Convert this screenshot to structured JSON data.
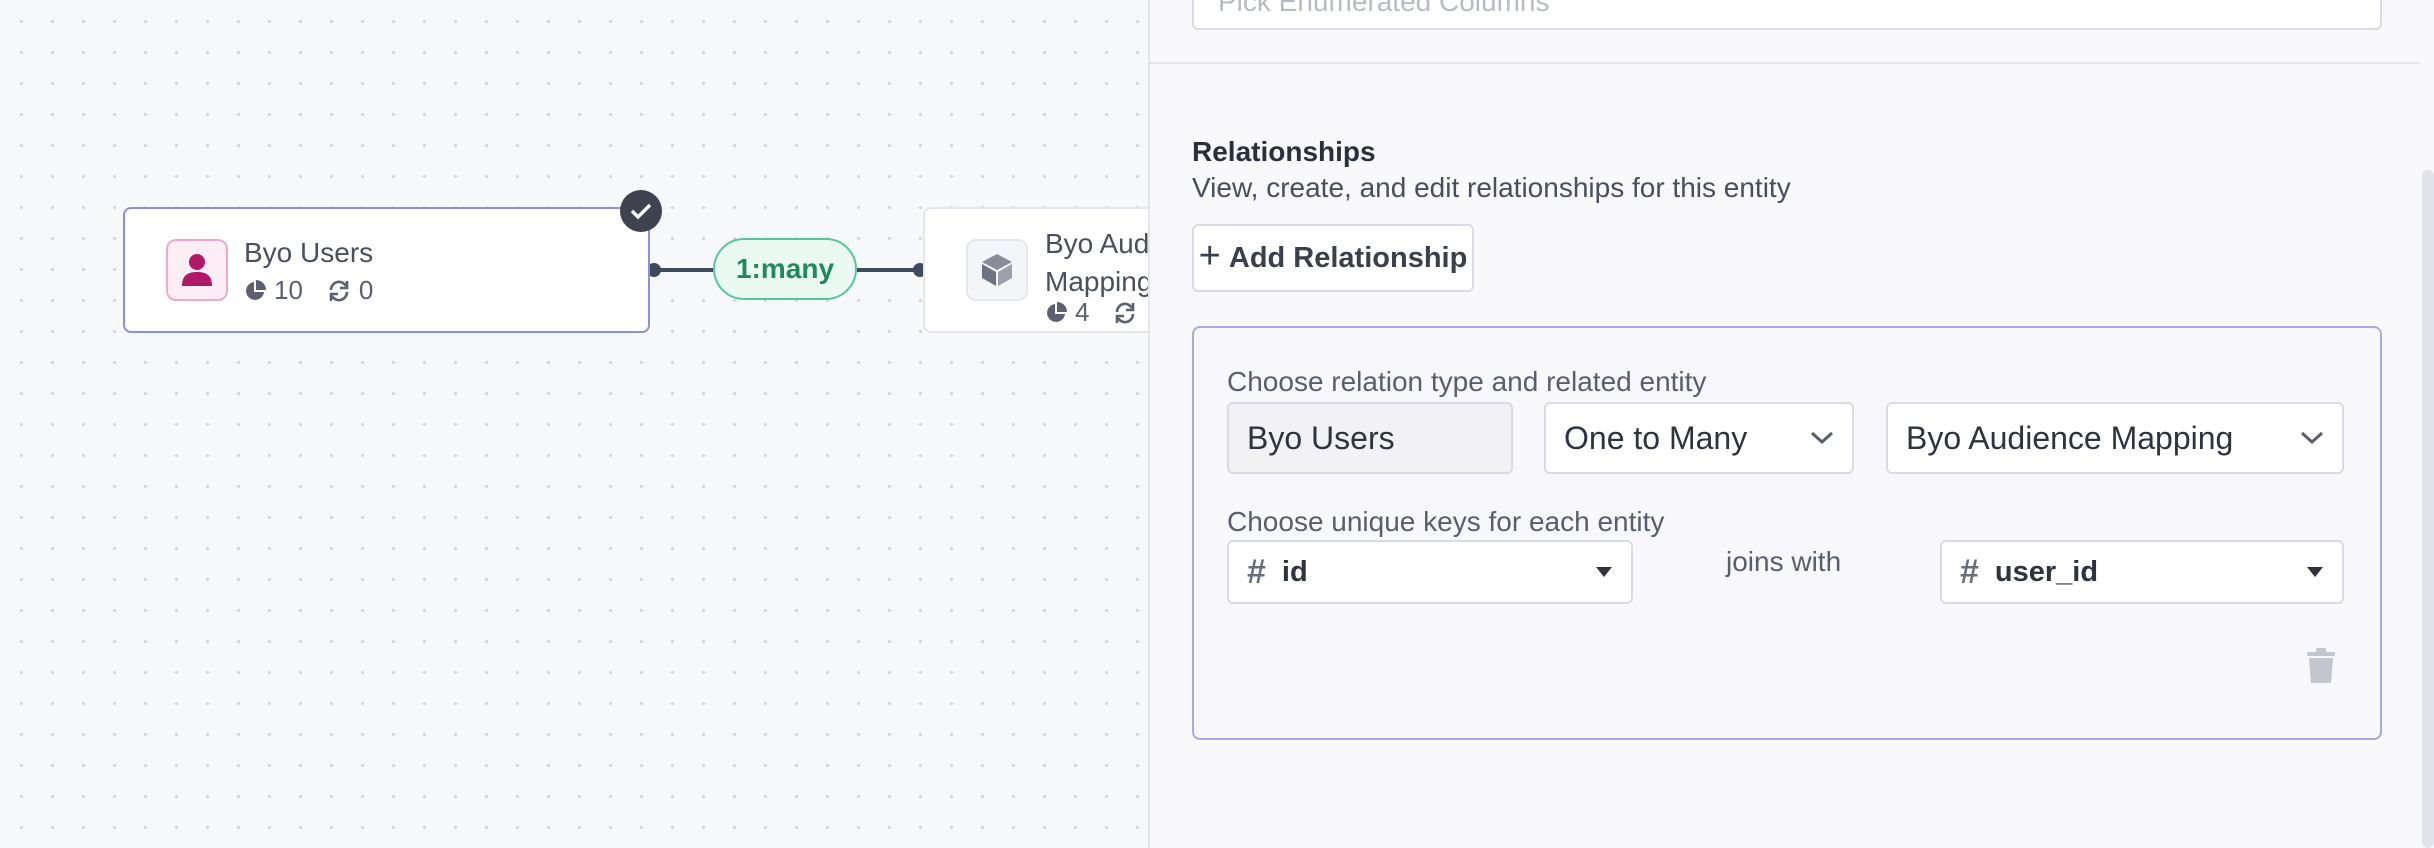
{
  "canvas": {
    "source_node": {
      "title": "Byo Users",
      "stat_a": "10",
      "stat_b": "0",
      "icon": "user-icon"
    },
    "target_node": {
      "title": "Byo Audience Mapping",
      "stat_a": "4",
      "icon": "cube-icon"
    },
    "edge_label": "1:many"
  },
  "panel": {
    "enum_placeholder": "Pick Enumerated Columns",
    "relationships": {
      "title": "Relationships",
      "subtitle": "View, create, and edit relationships for this entity",
      "add_button": "Add Relationship",
      "card": {
        "type_label": "Choose relation type and related entity",
        "source_entity": "Byo Users",
        "relation_type": "One to Many",
        "related_entity": "Byo Audience Mapping",
        "keys_label": "Choose unique keys for each entity",
        "source_key": "id",
        "joins_label": "joins with",
        "target_key": "user_id"
      }
    }
  },
  "colors": {
    "accent": "#8c8fe0",
    "edge_green": "#1f8a5b",
    "user_icon_pink": "#b0196a"
  }
}
